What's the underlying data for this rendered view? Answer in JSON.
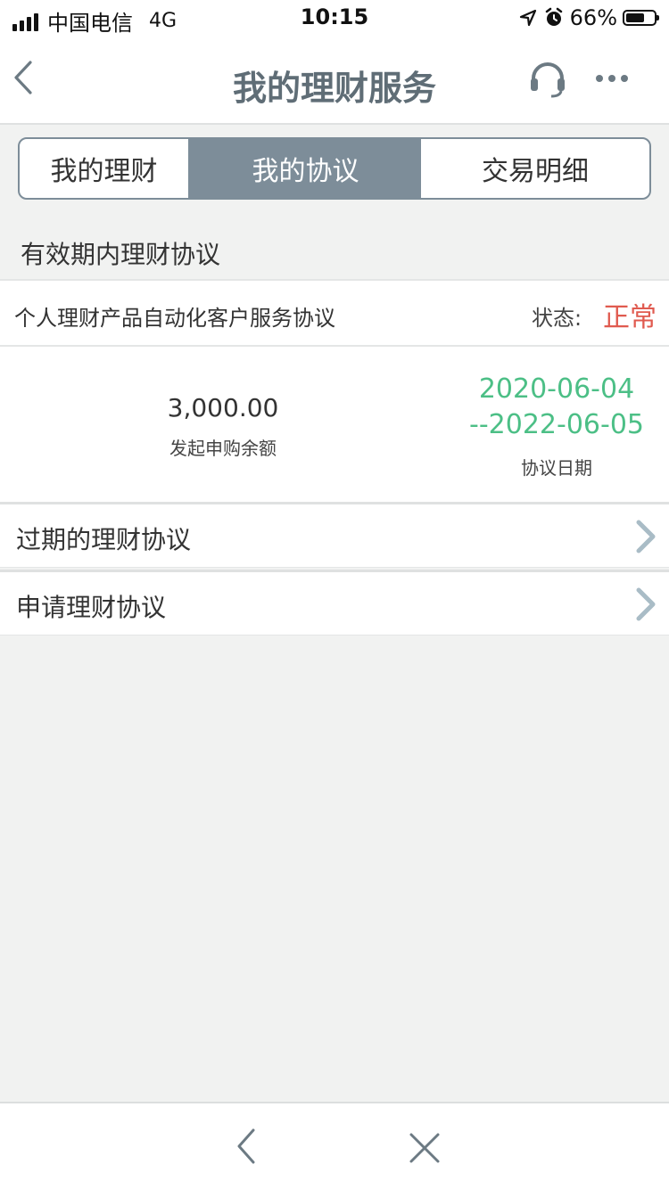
{
  "status_bar": {
    "carrier": "中国电信",
    "network": "4G",
    "time": "10:15",
    "battery_percent": "66%",
    "battery_level": 0.66
  },
  "nav": {
    "title": "我的理财服务",
    "back_icon": "chevron-left-icon",
    "service_icon": "headset-icon",
    "more_icon": "more-dots-icon"
  },
  "tabs": [
    {
      "label": "我的理财",
      "active": false
    },
    {
      "label": "我的协议",
      "active": true
    },
    {
      "label": "交易明细",
      "active": false
    }
  ],
  "section": {
    "title": "有效期内理财协议"
  },
  "agreement": {
    "name": "个人理财产品自动化客户服务协议",
    "status_label": "状态:",
    "status_value": "正常",
    "amount": "3,000.00",
    "amount_label": "发起申购余额",
    "date_start": "2020-06-04",
    "date_end": "--2022-06-05",
    "date_label": "协议日期"
  },
  "list": [
    {
      "label": "过期的理财协议"
    },
    {
      "label": "申请理财协议"
    }
  ],
  "colors": {
    "accent": "#7d8d99",
    "title": "#5f6d76",
    "status_normal": "#e05a4f",
    "date": "#4cbf86",
    "background": "#f1f2f1"
  },
  "bottom_bar": {
    "back_icon": "chevron-left-icon",
    "close_icon": "close-icon"
  }
}
